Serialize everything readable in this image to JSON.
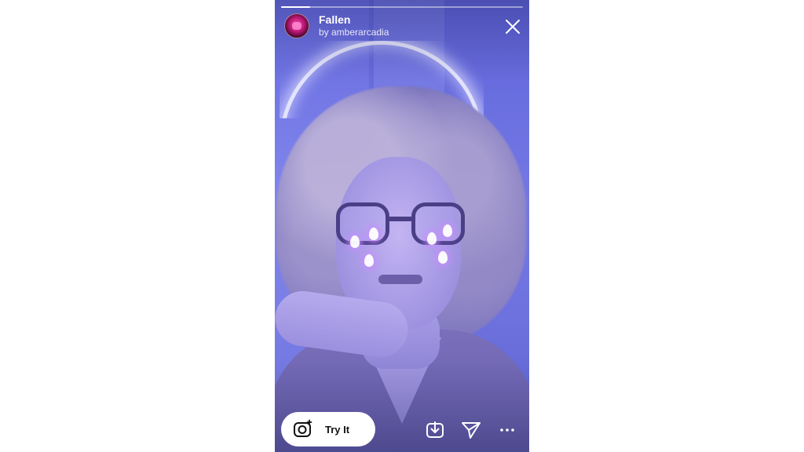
{
  "story": {
    "progress": 0.12,
    "effect_name": "Fallen",
    "creator": "by amberarcadia",
    "try_label": "Try It",
    "icons": {
      "avatar": "effect-avatar",
      "close": "close-icon",
      "camera": "camera-icon",
      "save": "save-icon",
      "share": "send-icon",
      "more": "more-icon"
    },
    "colors": {
      "accent": "#ffffff",
      "button_bg": "#ffffff",
      "button_text": "#111111"
    }
  }
}
